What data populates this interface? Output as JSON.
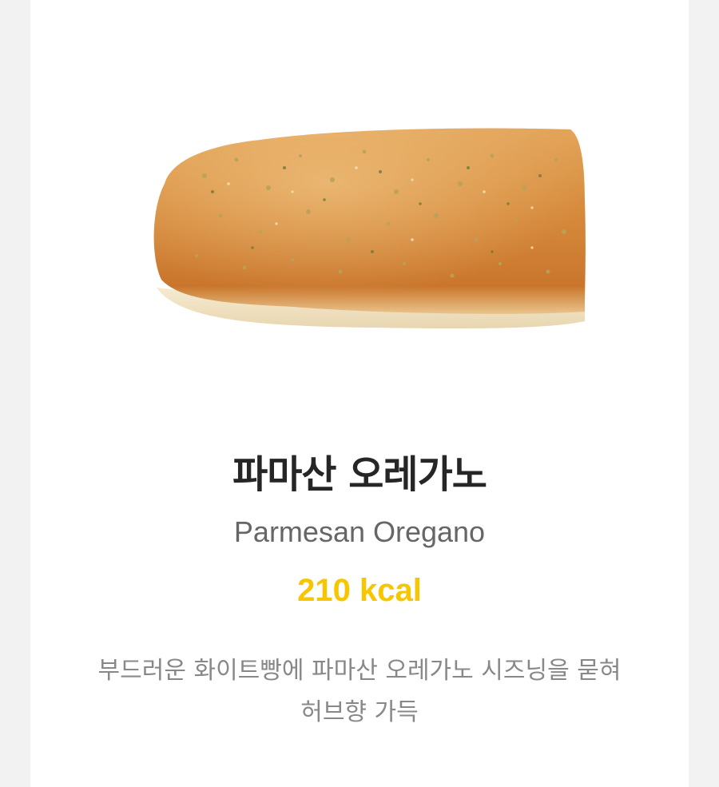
{
  "product": {
    "name_ko": "파마산 오레가노",
    "name_en": "Parmesan Oregano",
    "kcal": "210 kcal",
    "description": "부드러운 화이트빵에 파마산 오레가노 시즈닝을 묻혀 허브향 가득"
  },
  "colors": {
    "kcal": "#f7c600",
    "background": "#f2f2f2",
    "card": "#ffffff"
  }
}
